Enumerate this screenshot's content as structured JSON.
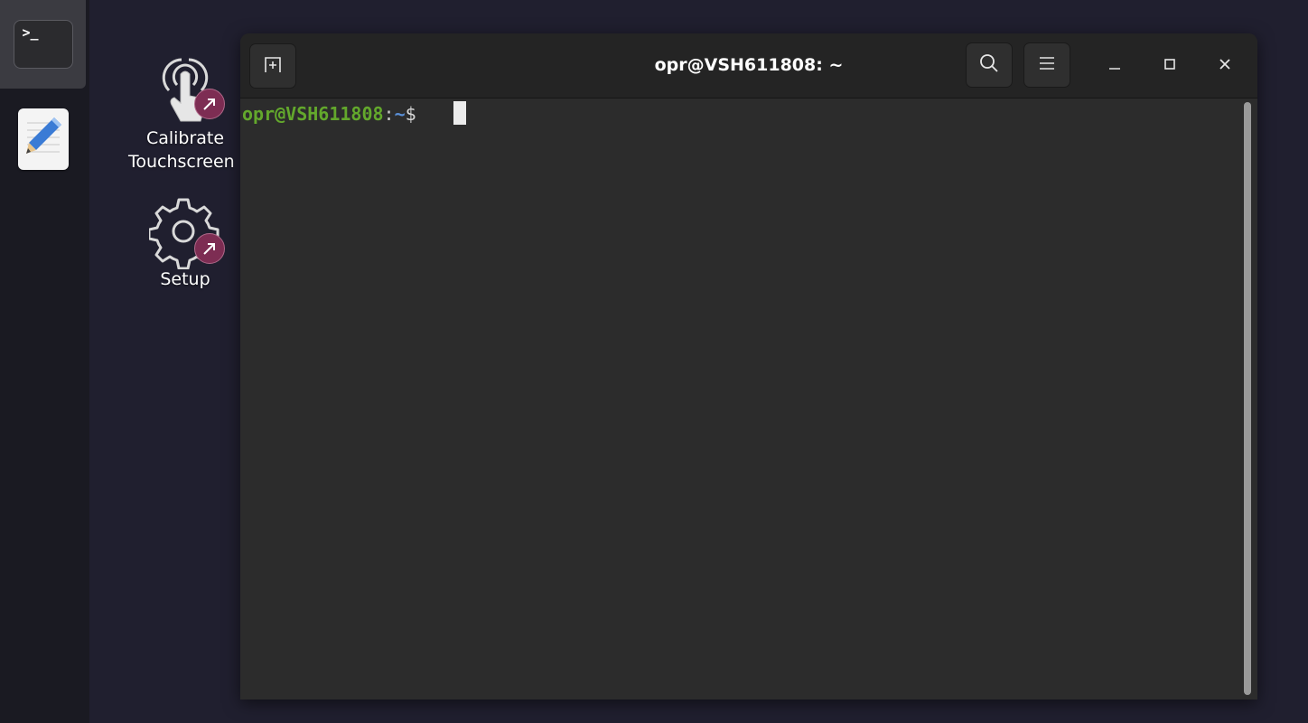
{
  "dock": {
    "items": [
      {
        "name": "Terminal",
        "icon": "terminal-icon",
        "glyph": ">_",
        "running": true
      },
      {
        "name": "Text Editor",
        "icon": "text-editor-icon"
      }
    ]
  },
  "desktop": {
    "icons": [
      {
        "label_line1": "Calibrate",
        "label_line2": "Touchscreen",
        "icon": "touch-hand-icon",
        "badge": "link-arrow-icon"
      },
      {
        "label": "Setup",
        "icon": "gear-icon",
        "badge": "link-arrow-icon"
      }
    ]
  },
  "window": {
    "title": "opr@VSH611808: ~",
    "headerbar": {
      "new_tab_icon": "new-tab-icon",
      "search_icon": "search-icon",
      "menu_icon": "hamburger-menu-icon"
    },
    "controls": {
      "minimize_icon": "minimize-icon",
      "maximize_icon": "maximize-icon",
      "close_icon": "close-icon"
    }
  },
  "terminal": {
    "prompt_user": "opr@VSH611808",
    "prompt_sep": ":",
    "prompt_dir": "~",
    "prompt_symbol": "$ "
  },
  "colors": {
    "desktop_bg": "#201f2f",
    "prompt_user": "#63a82c",
    "prompt_dir": "#5a8fd6",
    "badge": "#7d2d53",
    "running_indicator": "#e95420"
  }
}
